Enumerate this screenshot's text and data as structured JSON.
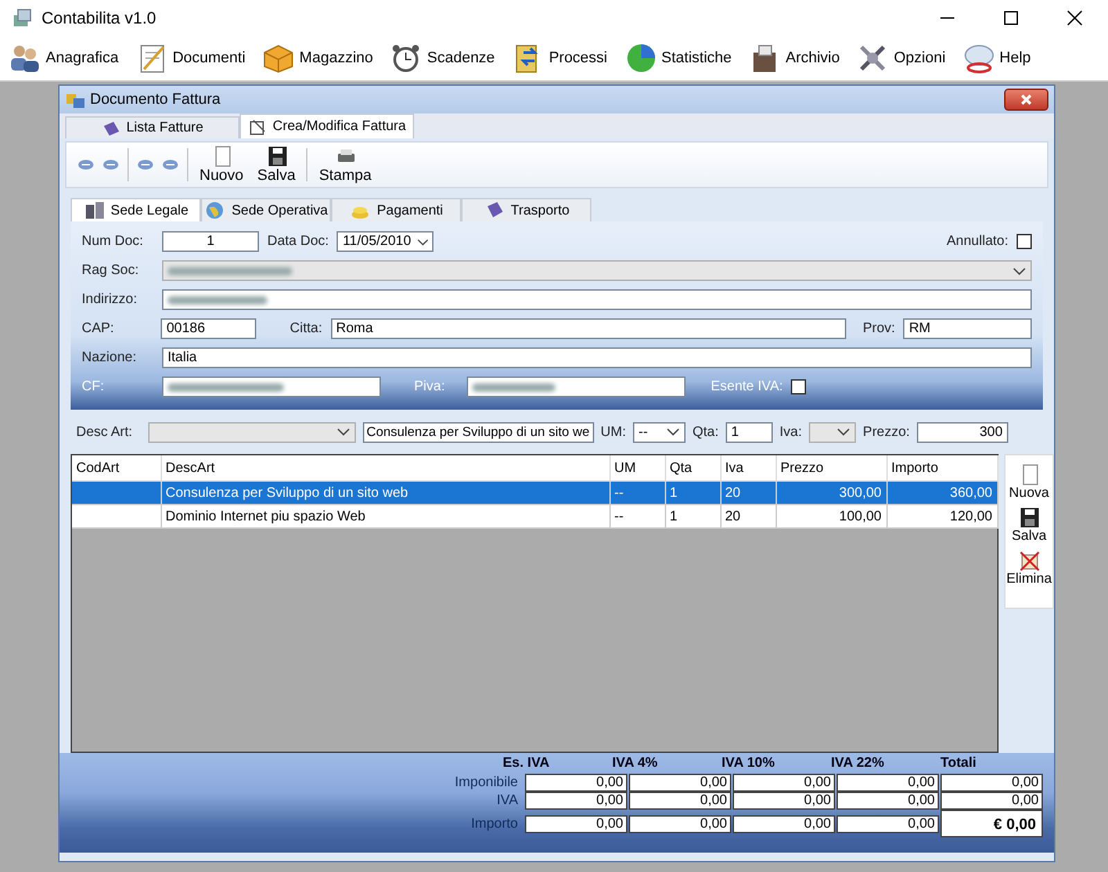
{
  "window": {
    "title": "Contabilita v1.0"
  },
  "menu": [
    {
      "label": "Anagrafica"
    },
    {
      "label": "Documenti"
    },
    {
      "label": "Magazzino"
    },
    {
      "label": "Scadenze"
    },
    {
      "label": "Processi"
    },
    {
      "label": "Statistiche"
    },
    {
      "label": "Archivio"
    },
    {
      "label": "Opzioni"
    },
    {
      "label": "Help"
    }
  ],
  "document_window": {
    "title": "Documento Fattura",
    "tabs": [
      {
        "label": "Lista Fatture",
        "selected": false
      },
      {
        "label": "Crea/Modifica Fattura",
        "selected": true
      }
    ],
    "toolbar": [
      {
        "kind": "nav"
      },
      {
        "kind": "nav"
      },
      {
        "kind": "nav"
      },
      {
        "kind": "nav"
      },
      {
        "kind": "button",
        "label": "Nuovo"
      },
      {
        "kind": "button",
        "label": "Salva"
      },
      {
        "kind": "button",
        "label": "Stampa"
      }
    ],
    "section_tabs": [
      {
        "label": "Sede Legale",
        "selected": true
      },
      {
        "label": "Sede Operativa",
        "selected": false
      },
      {
        "label": "Pagamenti",
        "selected": false
      },
      {
        "label": "Trasporto",
        "selected": false
      }
    ],
    "form": {
      "num_doc_label": "Num Doc:",
      "num_doc": "1",
      "data_doc_label": "Data Doc:",
      "data_doc": "11/05/2010",
      "annullato_label": "Annullato:",
      "annullato": false,
      "rag_soc_label": "Rag Soc:",
      "indirizzo_label": "Indirizzo:",
      "cap_label": "CAP:",
      "cap": "00186",
      "citta_label": "Citta:",
      "citta": "Roma",
      "prov_label": "Prov:",
      "prov": "RM",
      "nazione_label": "Nazione:",
      "nazione": "Italia",
      "cf_label": "CF:",
      "piva_label": "Piva:",
      "esente_iva_label": "Esente IVA:",
      "esente_iva": false
    },
    "article": {
      "desc_art_label": "Desc Art:",
      "description": "Consulenza per Sviluppo di un sito we",
      "um_label": "UM:",
      "um": "--",
      "qta_label": "Qta:",
      "qta": "1",
      "iva_label": "Iva:",
      "prezzo_label": "Prezzo:",
      "prezzo": "300"
    },
    "table": {
      "columns": [
        "CodArt",
        "DescArt",
        "UM",
        "Qta",
        "Iva",
        "Prezzo",
        "Importo"
      ],
      "rows": [
        {
          "selected": true,
          "cells": [
            "",
            "Consulenza per Sviluppo di un sito web",
            "--",
            "1",
            "20",
            "300,00",
            "360,00"
          ]
        },
        {
          "selected": false,
          "cells": [
            "",
            "Dominio Internet piu spazio Web",
            "--",
            "1",
            "20",
            "100,00",
            "120,00"
          ]
        }
      ]
    },
    "side_buttons": [
      {
        "label": "Nuova"
      },
      {
        "label": "Salva"
      },
      {
        "label": "Elimina"
      }
    ],
    "totals": {
      "columns": [
        "Es. IVA",
        "IVA 4%",
        "IVA 10%",
        "IVA 22%",
        "Totali"
      ],
      "rows": [
        {
          "label": "Imponibile",
          "values": [
            "0,00",
            "0,00",
            "0,00",
            "0,00",
            "0,00"
          ]
        },
        {
          "label": "IVA",
          "values": [
            "0,00",
            "0,00",
            "0,00",
            "0,00",
            "0,00"
          ]
        },
        {
          "label": "Importo",
          "values": [
            "0,00",
            "0,00",
            "0,00",
            "0,00"
          ]
        }
      ],
      "grand_total": "€ 0,00"
    }
  }
}
